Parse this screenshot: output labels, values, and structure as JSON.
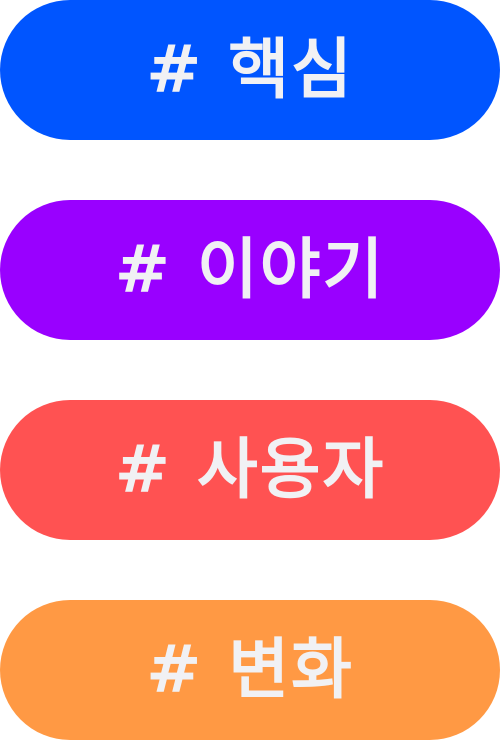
{
  "tags": [
    {
      "label": "# 핵심",
      "color": "#0055ff"
    },
    {
      "label": "# 이야기",
      "color": "#9900ff"
    },
    {
      "label": "# 사용자",
      "color": "#ff5252"
    },
    {
      "label": "# 변화",
      "color": "#ff9944"
    }
  ]
}
